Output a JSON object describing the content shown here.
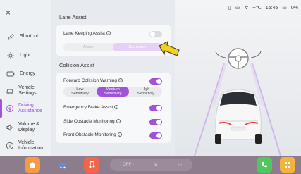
{
  "sidebar": {
    "close": "×",
    "items": [
      {
        "label": "Shortcut",
        "icon": "pen-icon"
      },
      {
        "label": "Light",
        "icon": "light-icon"
      },
      {
        "label": "Energy",
        "icon": "battery-icon"
      },
      {
        "label": "Vehicle Settings",
        "icon": "car-icon"
      },
      {
        "label": "Driving Assistance",
        "icon": "steering-wheel-icon",
        "active": true
      },
      {
        "label": "Volume & Display",
        "icon": "speaker-icon"
      },
      {
        "label": "Vehicle Information",
        "icon": "info-icon"
      }
    ]
  },
  "lane_assist": {
    "title": "Lane Assist",
    "keeping_label": "Lane Keeping Assist",
    "keeping_on": false,
    "modes": [
      "Alarm",
      "Correction"
    ],
    "selected_mode": "Correction"
  },
  "collision_assist": {
    "title": "Collision Assist",
    "fcw_label": "Forward Collision Warning",
    "sensitivity": [
      {
        "line1": "Low",
        "line2": "Sensitivity"
      },
      {
        "line1": "Medium",
        "line2": "Sensitivity"
      },
      {
        "line1": "High",
        "line2": "Sensitivity"
      }
    ],
    "selected_sensitivity": "Medium",
    "emergency_brake_label": "Emergency Brake Assist",
    "side_obstacle_label": "Side Obstacle Monitoring",
    "front_obstacle_label": "Front Obstacle Monitoring"
  },
  "status": {
    "temp": "--℃",
    "time": "15:45",
    "battery": "0%"
  },
  "dock": {
    "climate_left": "‹ OFF ›",
    "colors": {
      "home": "#f59a45",
      "music": "#f0664b",
      "phone": "#4fc65f",
      "apps": "#f4b33f"
    }
  },
  "colors": {
    "accent": "#a052d8",
    "arrow": "#f2d21a"
  }
}
